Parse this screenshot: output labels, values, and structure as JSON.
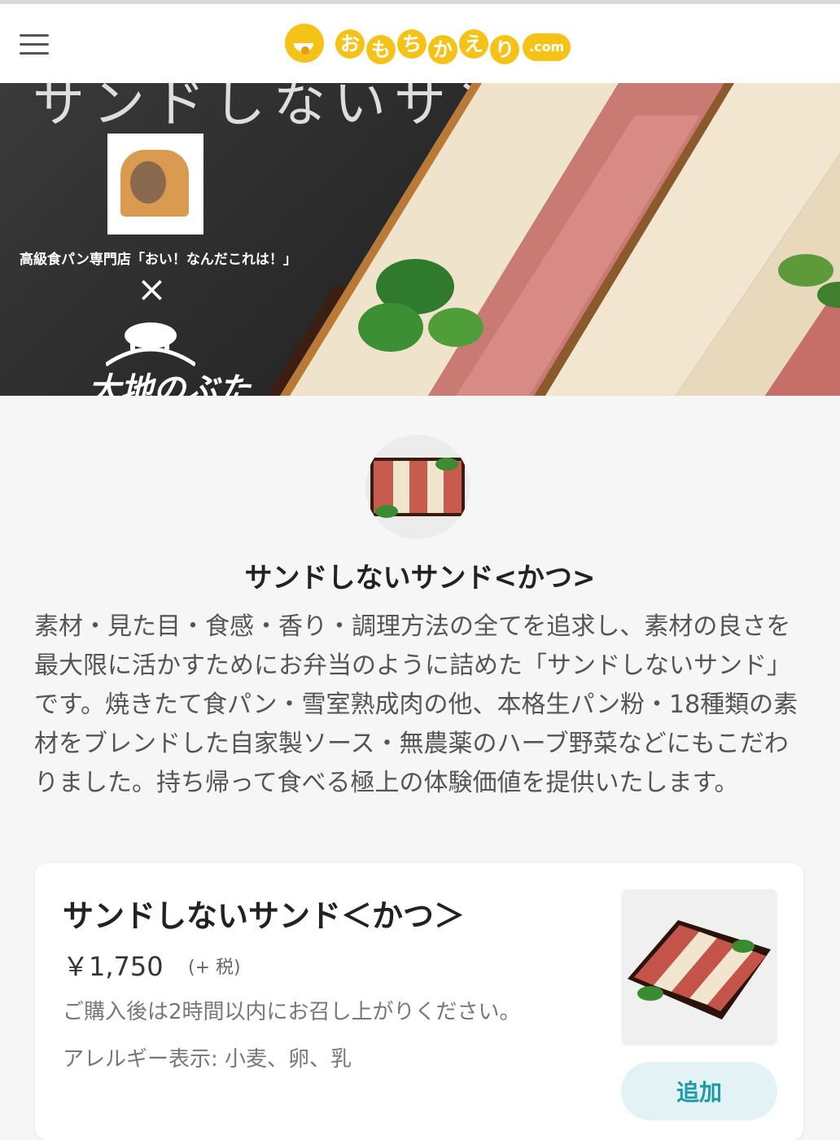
{
  "header": {
    "logo_text": [
      "お",
      "も",
      "ち",
      "か",
      "え",
      "り"
    ],
    "logo_suffix": ".com",
    "logo_color": "#f5c218"
  },
  "hero": {
    "slogan": "サンドしないサンド<かつ>",
    "shop_caption": "高級食パン専門店「おい！なんだこれは！」",
    "cross": "×",
    "brand2": "大地のぶた"
  },
  "shop": {
    "name": "サンドしないサンド<かつ>",
    "description": "素材・見た目・食感・香り・調理方法の全てを追求し、素材の良さを 最大限に活かすためにお弁当のように詰めた「サンドしないサンド」 です。焼きたて食パン・雪室熟成肉の他、本格生パン粉・18種類の素 材をブレンドした自家製ソース・無農薬のハーブ野菜などにもこだわ りました。持ち帰って食べる極上の体験価値を提供いたします。"
  },
  "menu_item": {
    "title": "サンドしないサンド＜かつ＞",
    "price": "￥1,750",
    "tax": "(+ 税)",
    "note": "ご購入後は2時間以内にお召し上がりください。",
    "allergy": "アレルギー表示: 小麦、卵、乳",
    "add_label": "追加"
  },
  "colors": {
    "accent_button_bg": "#e3f3f5",
    "accent_button_text": "#1b9aa8",
    "hero_bg": "#2f2f2f"
  },
  "icons": {
    "menu": "hamburger-menu-icon"
  }
}
